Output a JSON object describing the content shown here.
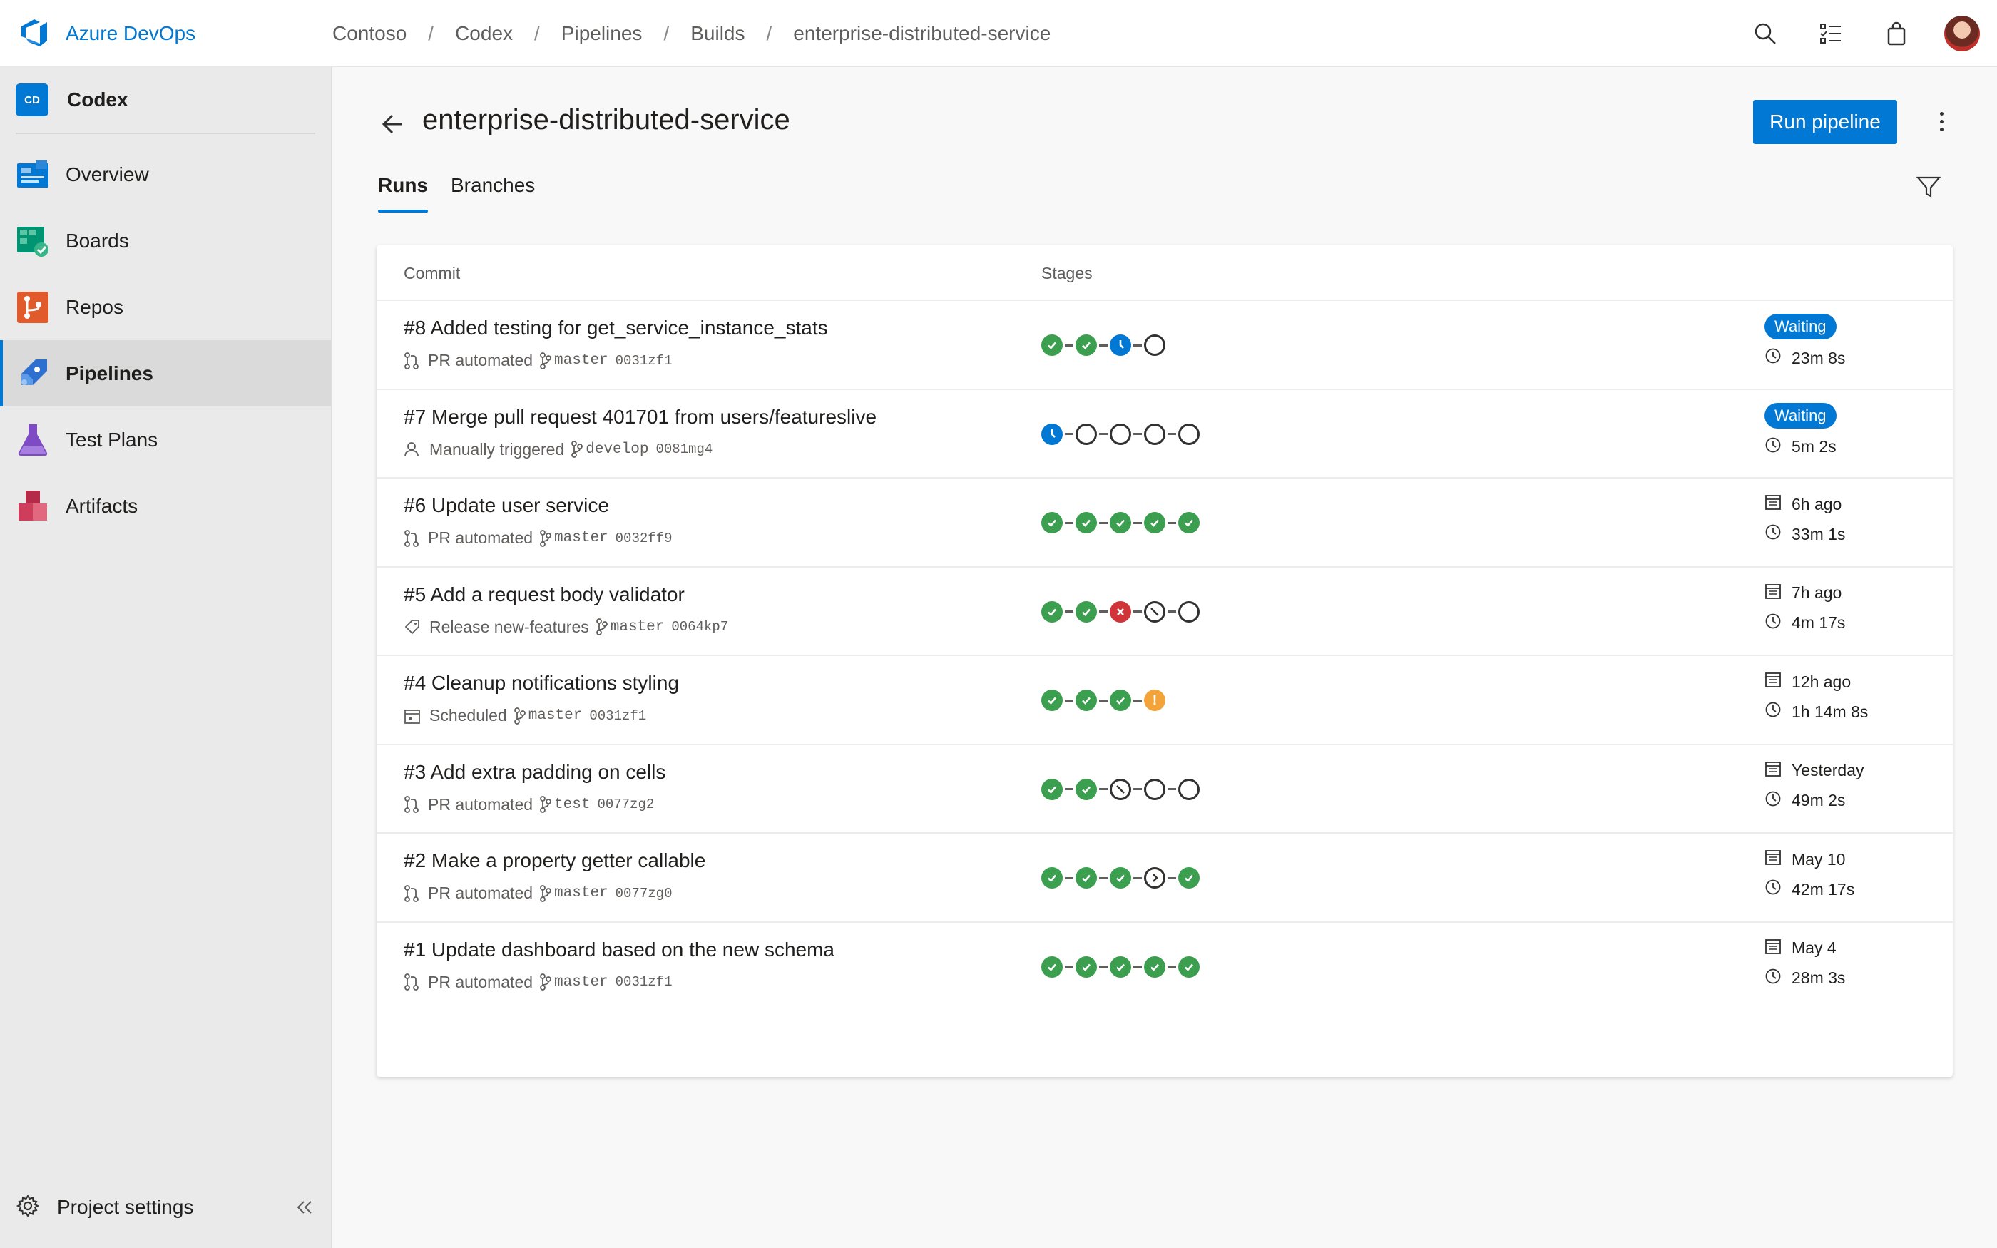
{
  "app": {
    "name": "Azure DevOps"
  },
  "breadcrumb": [
    "Contoso",
    "Codex",
    "Pipelines",
    "Builds",
    "enterprise-distributed-service"
  ],
  "sidebar": {
    "project_badge": "CD",
    "project_name": "Codex",
    "items": [
      {
        "label": "Overview",
        "icon": "overview-icon",
        "color": "#0078d4"
      },
      {
        "label": "Boards",
        "icon": "boards-icon",
        "color": "#009473"
      },
      {
        "label": "Repos",
        "icon": "repos-icon",
        "color": "#e05a2b"
      },
      {
        "label": "Pipelines",
        "icon": "pipelines-icon",
        "color": "#2f6fcf",
        "active": true
      },
      {
        "label": "Test Plans",
        "icon": "test-plans-icon",
        "color": "#7e4bc4"
      },
      {
        "label": "Artifacts",
        "icon": "artifacts-icon",
        "color": "#cf3d5c"
      }
    ],
    "settings_label": "Project settings"
  },
  "page": {
    "title": "enterprise-distributed-service",
    "run_button": "Run pipeline",
    "tabs": [
      "Runs",
      "Branches"
    ],
    "columns": {
      "commit": "Commit",
      "stages": "Stages"
    }
  },
  "runs": [
    {
      "title": "#8 Added testing for get_service_instance_stats",
      "trigger_icon": "pull-request-icon",
      "trigger": "PR automated",
      "branch": "master",
      "hash": "0031zf1",
      "stages": [
        "ok",
        "ok",
        "run",
        "pending"
      ],
      "badge": "Waiting",
      "date": "",
      "duration": "23m 8s"
    },
    {
      "title": "#7 Merge pull request 401701 from users/featureslive",
      "trigger_icon": "person-icon",
      "trigger": "Manually triggered",
      "branch": "develop",
      "hash": "0081mg4",
      "stages": [
        "run",
        "pending",
        "pending",
        "pending",
        "pending"
      ],
      "badge": "Waiting",
      "date": "",
      "duration": "5m 2s"
    },
    {
      "title": "#6 Update user service",
      "trigger_icon": "pull-request-icon",
      "trigger": "PR automated",
      "branch": "master",
      "hash": "0032ff9",
      "stages": [
        "ok",
        "ok",
        "ok",
        "ok",
        "ok"
      ],
      "badge": "",
      "date": "6h ago",
      "duration": "33m 1s"
    },
    {
      "title": "#5 Add a request body validator",
      "trigger_icon": "tag-icon",
      "trigger": "Release new-features",
      "branch": "master",
      "hash": "0064kp7",
      "stages": [
        "ok",
        "ok",
        "fail",
        "skip",
        "pending"
      ],
      "badge": "",
      "date": "7h ago",
      "duration": "4m 17s"
    },
    {
      "title": "#4 Cleanup notifications styling",
      "trigger_icon": "calendar-icon",
      "trigger": "Scheduled",
      "branch": "master",
      "hash": "0031zf1",
      "stages": [
        "ok",
        "ok",
        "ok",
        "warn"
      ],
      "badge": "",
      "date": "12h ago",
      "duration": "1h 14m 8s"
    },
    {
      "title": "#3 Add extra padding on cells",
      "trigger_icon": "pull-request-icon",
      "trigger": "PR automated",
      "branch": "test",
      "hash": "0077zg2",
      "stages": [
        "ok",
        "ok",
        "skip",
        "pending",
        "pending"
      ],
      "badge": "",
      "date": "Yesterday",
      "duration": "49m 2s"
    },
    {
      "title": "#2 Make a property getter callable",
      "trigger_icon": "pull-request-icon",
      "trigger": "PR automated",
      "branch": "master",
      "hash": "0077zg0",
      "stages": [
        "ok",
        "ok",
        "ok",
        "queued",
        "ok"
      ],
      "badge": "",
      "date": "May 10",
      "duration": "42m 17s"
    },
    {
      "title": "#1 Update dashboard based on the new schema",
      "trigger_icon": "pull-request-icon",
      "trigger": "PR automated",
      "branch": "master",
      "hash": "0031zf1",
      "stages": [
        "ok",
        "ok",
        "ok",
        "ok",
        "ok"
      ],
      "badge": "",
      "date": "May 4",
      "duration": "28m 3s"
    }
  ],
  "colors": {
    "accent": "#0078d4",
    "success": "#3c9e4f",
    "failed": "#d13438",
    "warning": "#f2a33a"
  }
}
